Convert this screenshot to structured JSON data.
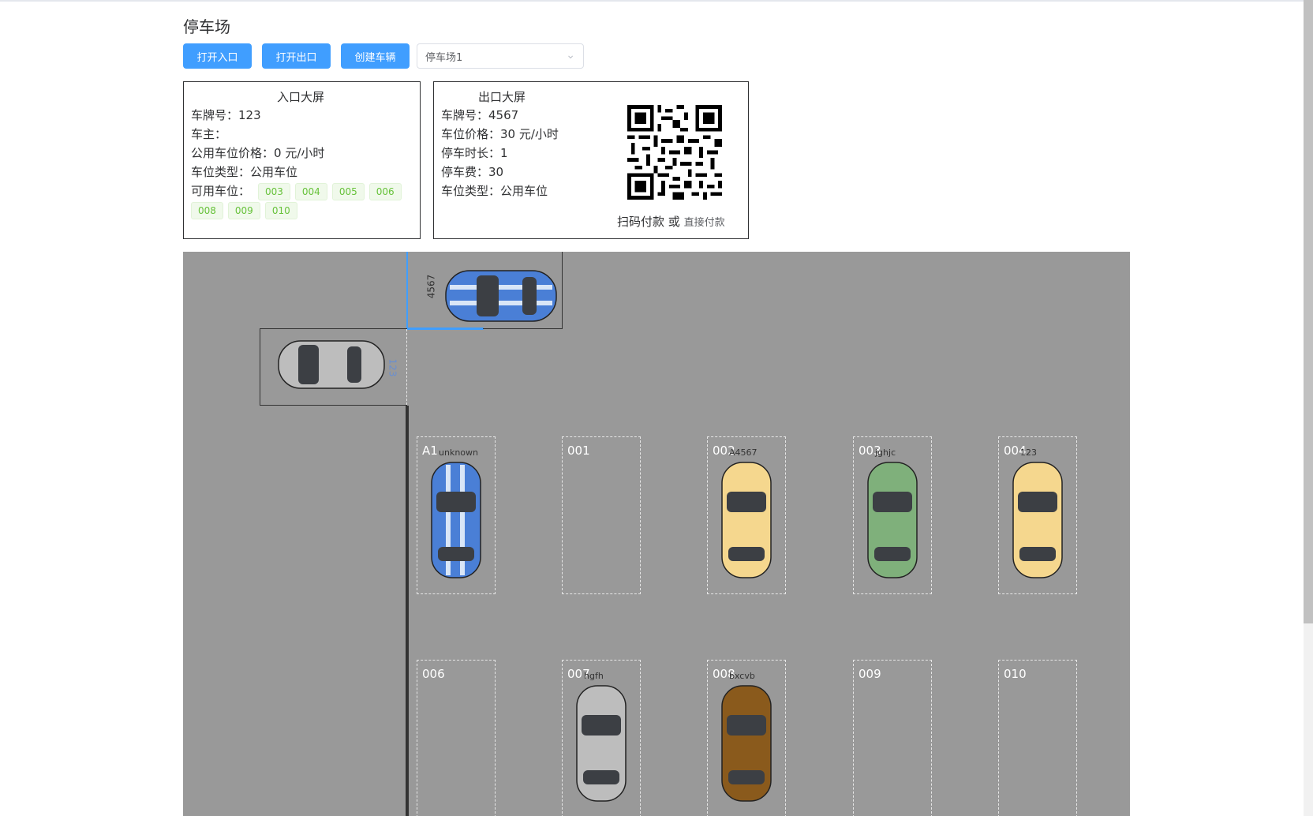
{
  "page": {
    "title": "停车场"
  },
  "toolbar": {
    "open_entrance": "打开入口",
    "open_exit": "打开出口",
    "create_vehicle": "创建车辆",
    "lot_select": "停车场1"
  },
  "entrance_screen": {
    "title": "入口大屏",
    "plate_label": "车牌号：",
    "plate": "123",
    "owner_label": "车主：",
    "owner": "",
    "price_label": "公用车位价格：",
    "price": "0 元/小时",
    "type_label": "车位类型：",
    "type": "公用车位",
    "available_label": "可用车位：",
    "available_spots": [
      "003",
      "004",
      "005",
      "006",
      "008",
      "009",
      "010"
    ]
  },
  "exit_screen": {
    "title": "出口大屏",
    "plate_label": "车牌号：",
    "plate": "4567",
    "price_label": "车位价格：",
    "price": "30 元/小时",
    "duration_label": "停车时长：",
    "duration": "1",
    "fee_label": "停车费：",
    "fee": "30",
    "type_label": "车位类型：",
    "type": "公用车位",
    "pay_text": "扫码付款 或",
    "pay_direct": "直接付款"
  },
  "parking_lot": {
    "exit_car_plate": "4567",
    "entrance_car_plate": "123",
    "spots": [
      {
        "id": "A1",
        "car_plate": "unknown",
        "car_color": "#4a7fd6",
        "striped": true
      },
      {
        "id": "001",
        "car_plate": "",
        "car_color": "",
        "striped": false
      },
      {
        "id": "002",
        "car_plate": "A4567",
        "car_color": "#f5d78e",
        "striped": false
      },
      {
        "id": "003",
        "car_plate": "jghjc",
        "car_color": "#7fb07b",
        "striped": false
      },
      {
        "id": "004",
        "car_plate": "123",
        "car_color": "#f5d78e",
        "striped": false
      },
      {
        "id": "006",
        "car_plate": "",
        "car_color": "",
        "striped": false
      },
      {
        "id": "007",
        "car_plate": "hgfh",
        "car_color": "#bdbdbd",
        "striped": false
      },
      {
        "id": "008",
        "car_plate": "bxcvb",
        "car_color": "#8a5a1c",
        "striped": false
      },
      {
        "id": "009",
        "car_plate": "",
        "car_color": "",
        "striped": false
      },
      {
        "id": "010",
        "car_plate": "",
        "car_color": "",
        "striped": false
      }
    ]
  }
}
